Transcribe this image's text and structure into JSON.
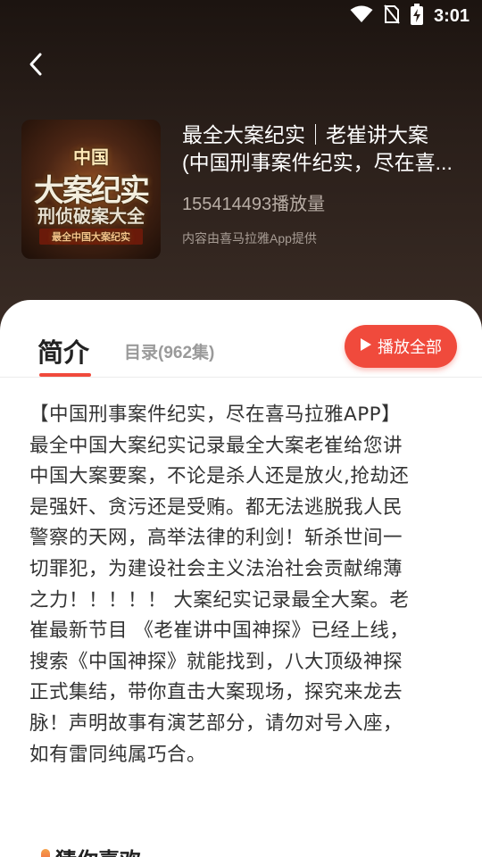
{
  "status_bar": {
    "time": "3:01",
    "icons": [
      "wifi-icon",
      "no-sim-icon",
      "battery-charging-icon"
    ]
  },
  "header": {
    "back_icon": "chevron-left-icon"
  },
  "album": {
    "cover_text": {
      "line1": "中国",
      "line2": "大案纪实",
      "line3": "刑侦破案大全",
      "line4": "最全中国大案纪实"
    },
    "title_line1": "最全大案纪实｜老崔讲大案",
    "title_line2": "(中国刑事案件纪实，尽在喜...",
    "play_count": "155414493播放量",
    "provider": "内容由喜马拉雅App提供"
  },
  "tabs": {
    "intro": "简介",
    "catalog": "目录(962集)"
  },
  "play_all": {
    "icon": "play-icon",
    "label": "播放全部"
  },
  "description": {
    "lines": [
      "【中国刑事案件纪实，尽在喜马拉雅APP】",
      "最全中国大案纪实记录最全大案老崔给您讲",
      "中国大案要案，不论是杀人还是放火,抢劫还",
      "是强奸、贪污还是受贿。都无法逃脱我人民",
      "警察的天网，高举法律的利剑！斩杀世间一",
      "切罪犯，为建设社会主义法治社会贡献绵薄",
      "之力！！！！！ 大案纪实记录最全大案。老",
      "崔最新节目 《老崔讲中国神探》已经上线，",
      "搜索《中国神探》就能找到，八大顶级神探",
      "正式集结，带你直击大案现场，探究来龙去",
      "脉！声明故事有演艺部分，请勿对号入座，",
      "如有雷同纯属巧合。"
    ]
  },
  "section": {
    "title": "猜你喜欢"
  },
  "colors": {
    "accent": "#f04a3c",
    "header_bg": "#2a1f1a",
    "text_primary": "#333333",
    "text_muted": "#9a9a9a"
  }
}
